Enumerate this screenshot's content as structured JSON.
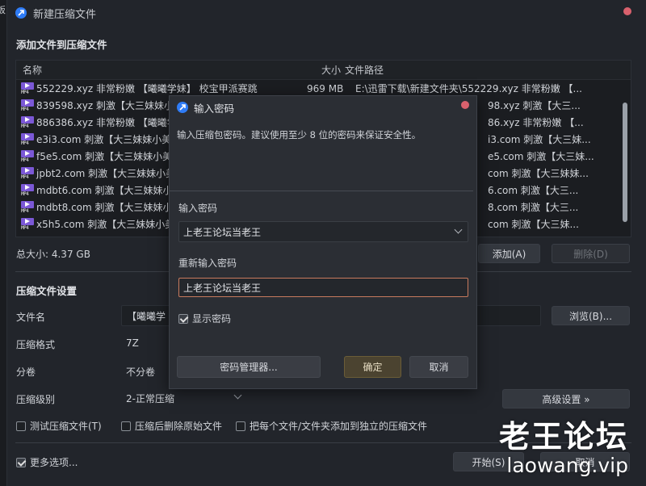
{
  "window": {
    "title": "新建压缩文件",
    "left_edge_char": "板"
  },
  "add_section": {
    "heading": "添加文件到压缩文件"
  },
  "file_list": {
    "columns": [
      "名称",
      "大小",
      "文件路径"
    ],
    "rows": [
      {
        "name": "552229.xyz 非常粉嫩 【曦曦学妹】 校宝甲派赛跳",
        "size": "969 MB",
        "path": "E:\\迅雷下载\\新建文件夹\\552229.xyz 非常粉嫩 【..."
      },
      {
        "name": "839598.xyz 刺激【大三妹妹小美",
        "size": "",
        "path": "98.xyz 刺激【大三..."
      },
      {
        "name": "886386.xyz 非常粉嫩 【曦曦学妹",
        "size": "",
        "path": "86.xyz 非常粉嫩 【..."
      },
      {
        "name": "e3i3.com 刺激【大三妹妹小美",
        "size": "",
        "path": "i3.com 刺激【大三妹..."
      },
      {
        "name": "f5e5.com 刺激【大三妹妹小美",
        "size": "",
        "path": "e5.com 刺激【大三妹..."
      },
      {
        "name": "jpbt2.com 刺激【大三妹妹小美",
        "size": "",
        "path": "com 刺激【大三妹妹..."
      },
      {
        "name": "mdbt6.com 刺激【大三妹妹小",
        "size": "",
        "path": "6.com 刺激【大三..."
      },
      {
        "name": "mdbt8.com 刺激【大三妹妹小",
        "size": "",
        "path": "8.com 刺激【大三..."
      },
      {
        "name": "x5h5.com 刺激【大三妹妹小美",
        "size": "",
        "path": "com 刺激【大三妹..."
      }
    ],
    "file_type_label": "MP4"
  },
  "total_size": "总大小: 4.37 GB",
  "list_buttons": {
    "add": "添加(A)",
    "delete": "删除(D)"
  },
  "settings": {
    "heading": "压缩文件设置",
    "filename_label": "文件名",
    "filename_value": "【曦曦学",
    "browse": "浏览(B)...",
    "format_label": "压缩格式",
    "format_value": "7Z",
    "split_label": "分卷",
    "split_value": "不分卷",
    "level_label": "压缩级别",
    "level_value": "2-正常压缩",
    "advanced": "高级设置 »",
    "opt_test": "测试压缩文件(T)",
    "opt_delete": "压缩后删除原始文件",
    "opt_each": "把每个文件/文件夹添加到独立的压缩文件",
    "more_options": "更多选项...",
    "start": "开始(S)",
    "cancel_partial": "取消"
  },
  "dialog": {
    "title": "输入密码",
    "description": "输入压缩包密码。建议使用至少 8 位的密码来保证安全性。",
    "password_label": "输入密码",
    "password_value": "上老王论坛当老王",
    "reenter_label": "重新输入密码",
    "reenter_value": "上老王论坛当老王",
    "show_password": "显示密码",
    "manager_button": "密码管理器...",
    "ok_button": "确定",
    "cancel_button": "取消"
  },
  "watermark": {
    "line1": "老王论坛",
    "line2": "laowang.vip"
  },
  "colors": {
    "accent": "#2f7cf6",
    "close": "#d9616d",
    "focus": "#c87a5d",
    "mp4": "#7b58d6"
  }
}
